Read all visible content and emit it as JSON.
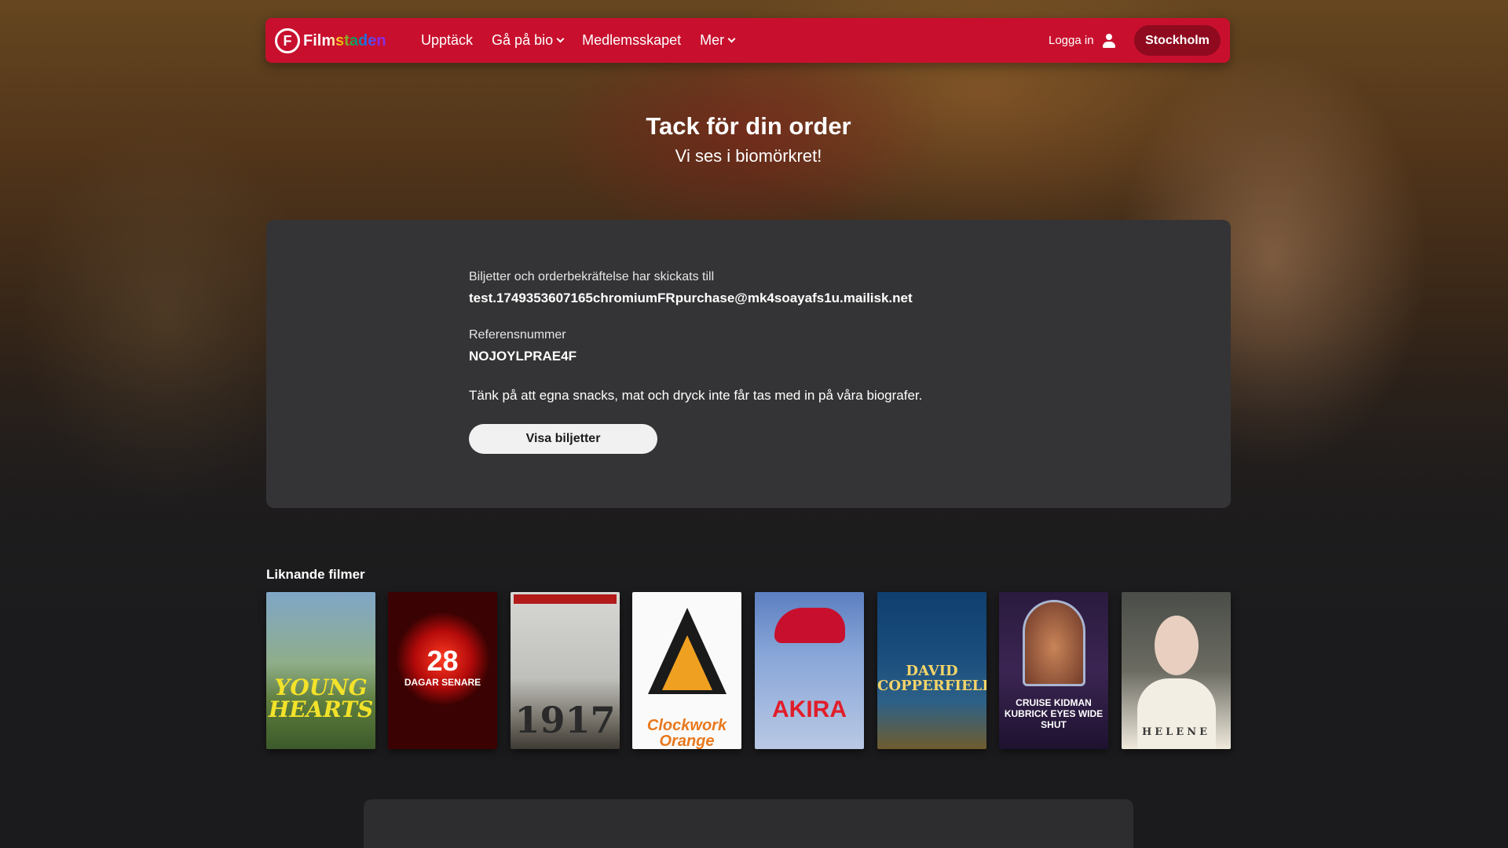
{
  "nav": {
    "logo_mark": "F",
    "logo_text": "Filmstaden",
    "links": [
      "Upptäck",
      "Gå på bio",
      "Medlemsskapet",
      "Mer"
    ],
    "login_label": "Logga in",
    "city_label": "Stockholm",
    "color": "#c8102e"
  },
  "hero": {
    "title": "Tack för din order",
    "subtitle": "Vi ses i biomörkret!"
  },
  "order": {
    "sent_label": "Biljetter och orderbekräftelse har skickats till",
    "email": "test.1749353607165chromiumFRpurchase@mk4soayafs1u.mailisk.net",
    "ref_label": "Referensnummer",
    "ref_value": "NOJOYLPRAE4F",
    "note": "Tänk på att egna snacks, mat och dryck inte får tas med in på våra biografer.",
    "button_label": "Visa biljetter"
  },
  "similar": {
    "title": "Liknande filmer",
    "posters": [
      {
        "title": "YOUNG HEARTS"
      },
      {
        "title": "28",
        "sub": "DAGAR SENARE"
      },
      {
        "title": "1917"
      },
      {
        "title": "Clockwork Orange"
      },
      {
        "title": "AKIRA"
      },
      {
        "title": "DAVID COPPERFIELDS"
      },
      {
        "title": "CRUISE KIDMAN KUBRICK EYES WIDE SHUT"
      },
      {
        "title": "HELENE"
      }
    ]
  }
}
